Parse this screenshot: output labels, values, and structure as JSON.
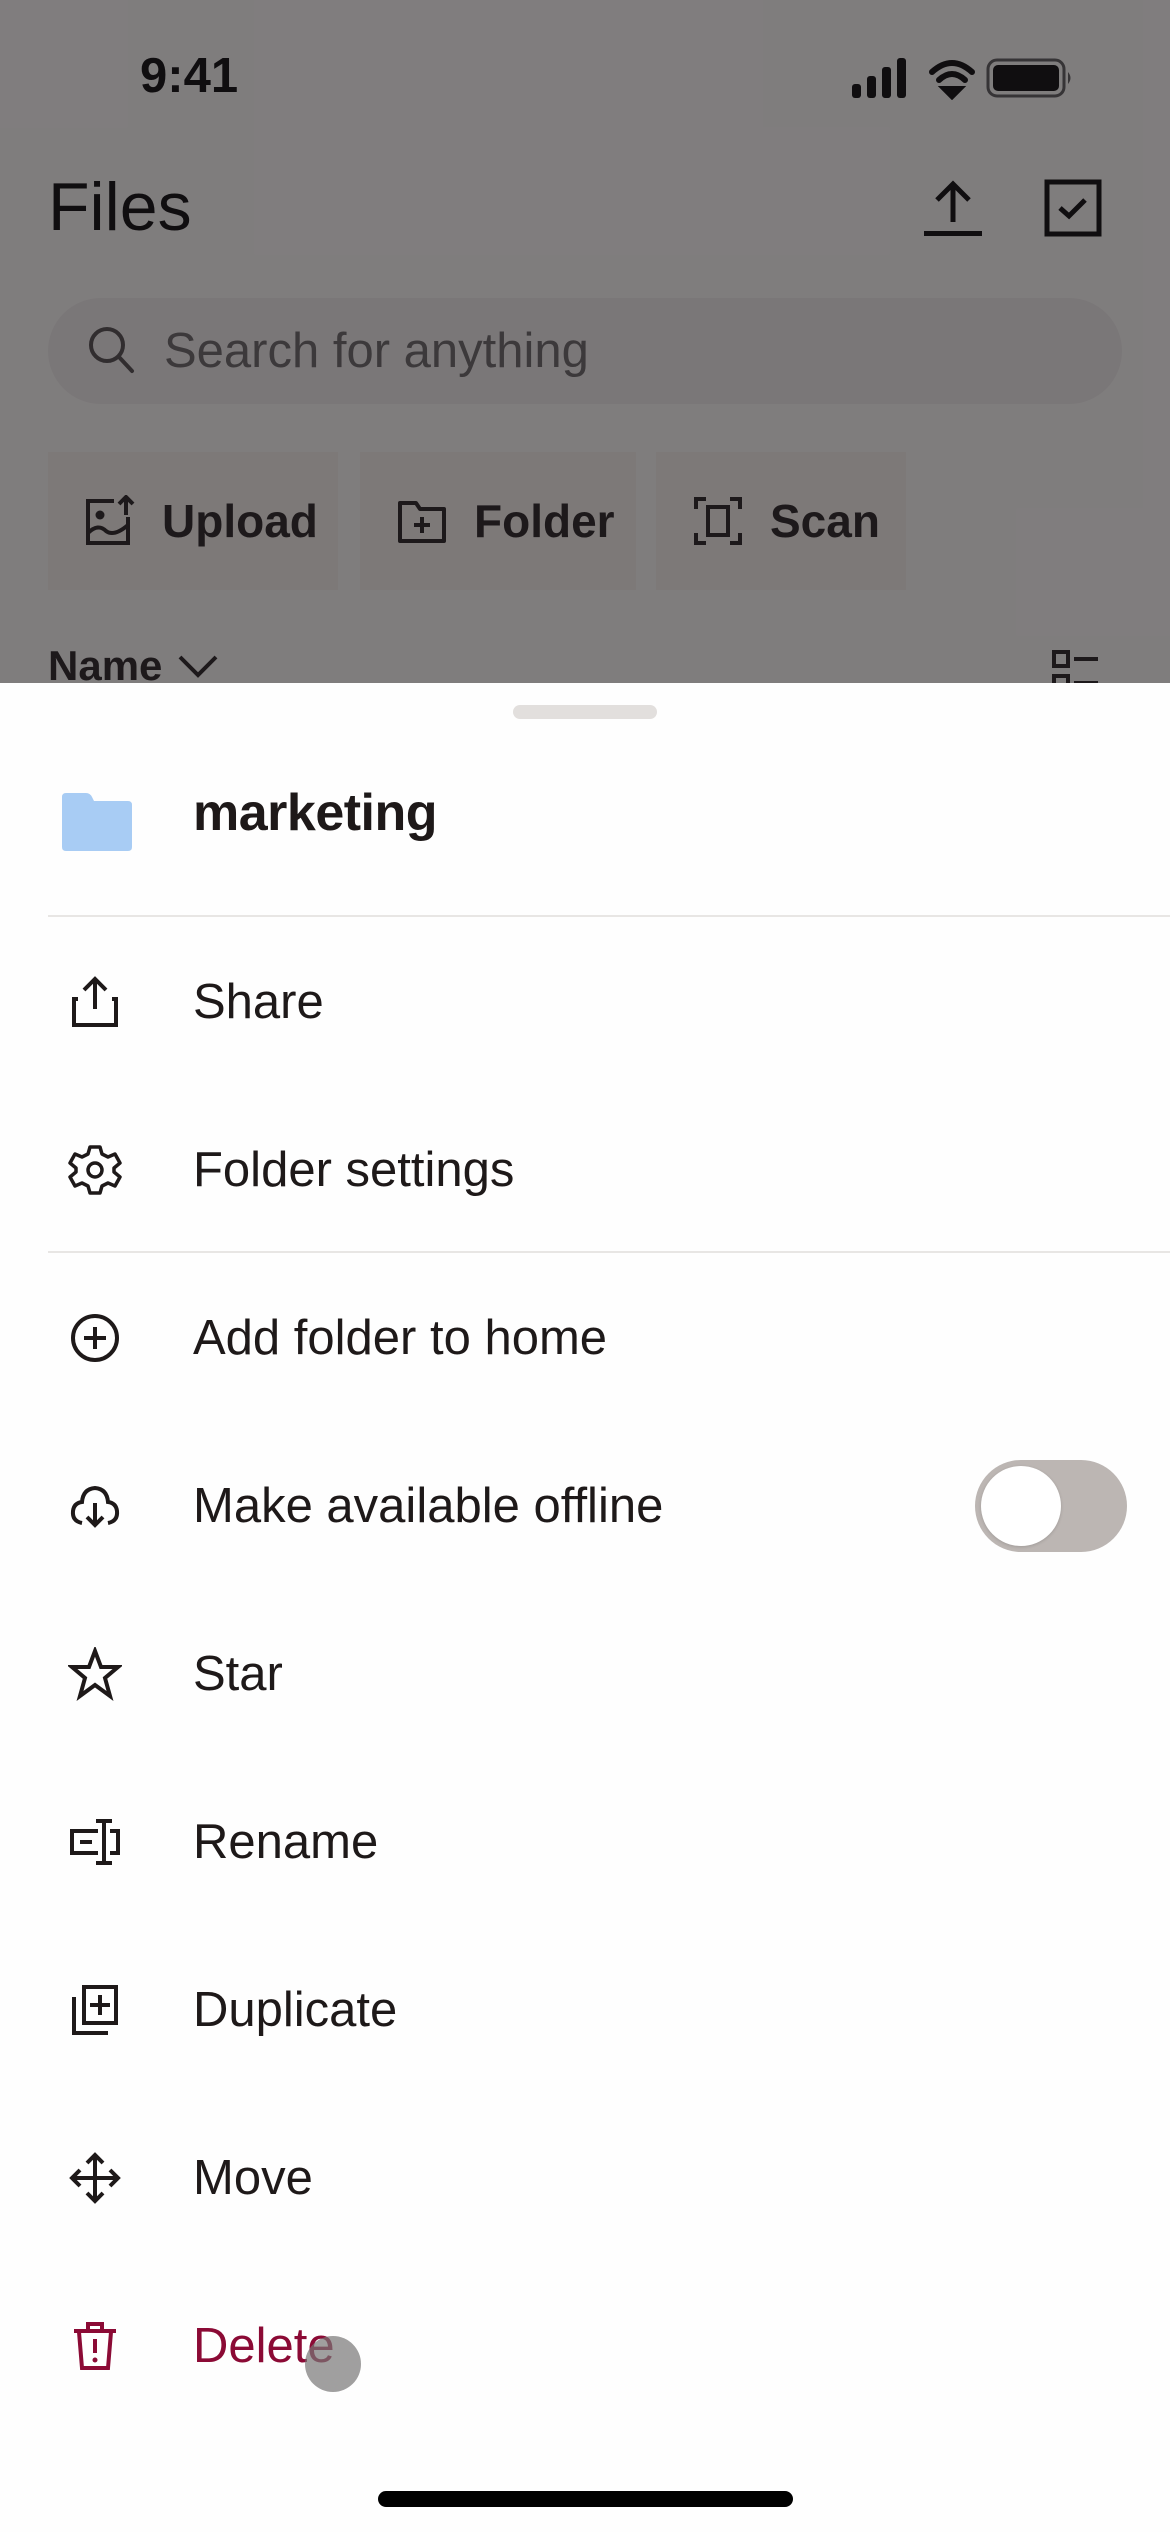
{
  "status_bar": {
    "time": "9:41",
    "icons": [
      "cellular-signal-icon",
      "wifi-icon",
      "battery-icon"
    ]
  },
  "header": {
    "title": "Files",
    "actions": [
      {
        "icon": "upload-icon",
        "label": "Upload"
      },
      {
        "icon": "select-checkbox-icon",
        "label": "Select"
      }
    ]
  },
  "search": {
    "placeholder": "Search for anything",
    "value": ""
  },
  "quick_actions": [
    {
      "icon": "upload-photo-icon",
      "label": "Upload"
    },
    {
      "icon": "new-folder-icon",
      "label": "Folder"
    },
    {
      "icon": "scan-icon",
      "label": "Scan"
    }
  ],
  "sort": {
    "label": "Name",
    "icon": "chevron-down-icon",
    "view_toggle_icon": "list-view-icon"
  },
  "sheet": {
    "folder_name": "marketing",
    "folder_icon_color": "#a8ccf4",
    "items": [
      {
        "label": "Share",
        "icon": "share-icon"
      },
      {
        "label": "Folder settings",
        "icon": "gear-icon"
      },
      {
        "label": "Add folder to home",
        "icon": "add-circle-icon"
      },
      {
        "label": "Make available offline",
        "icon": "cloud-download-icon",
        "toggle": false
      },
      {
        "label": "Star",
        "icon": "star-icon"
      },
      {
        "label": "Rename",
        "icon": "rename-icon"
      },
      {
        "label": "Duplicate",
        "icon": "duplicate-icon"
      },
      {
        "label": "Move",
        "icon": "move-icon"
      },
      {
        "label": "Delete",
        "icon": "trash-icon",
        "danger": true
      }
    ]
  },
  "colors": {
    "danger": "#8b0a35",
    "toggle_off": "#bcb6b3",
    "folder": "#a8ccf4"
  }
}
